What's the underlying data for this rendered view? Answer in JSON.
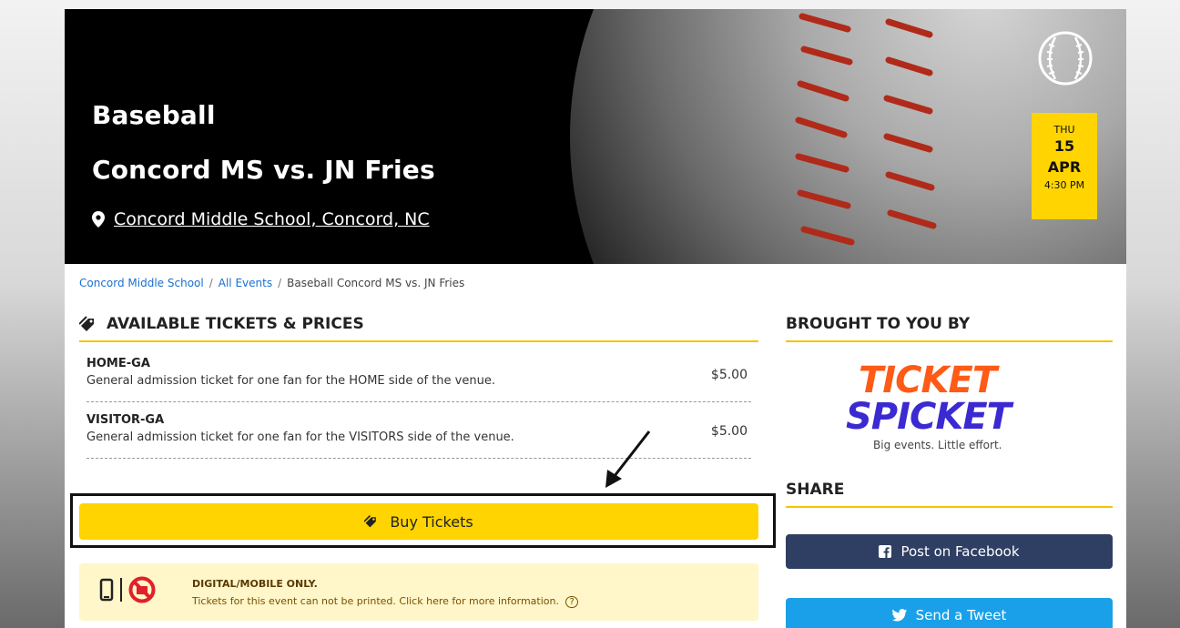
{
  "hero": {
    "sport": "Baseball",
    "matchup": "Concord MS vs. JN Fries",
    "venue": "Concord Middle School, Concord, NC",
    "date": {
      "dow": "THU",
      "day": "15",
      "month": "APR",
      "time": "4:30 PM"
    }
  },
  "breadcrumb": {
    "school": "Concord Middle School",
    "all_events": "All Events",
    "current": "Baseball Concord MS vs. JN Fries",
    "separator": "/"
  },
  "tickets_section": {
    "heading": "AVAILABLE TICKETS & PRICES",
    "tickets": [
      {
        "name": "HOME-GA",
        "description": "General admission ticket for one fan for the HOME side of the venue.",
        "price": "$5.00"
      },
      {
        "name": "VISITOR-GA",
        "description": "General admission ticket for one fan for the VISITORS side of the venue.",
        "price": "$5.00"
      }
    ],
    "buy_label": "Buy Tickets"
  },
  "notice": {
    "title": "DIGITAL/MOBILE ONLY.",
    "body": "Tickets for this event can not be printed. Click here for more information.",
    "help_glyph": "?"
  },
  "sidebar": {
    "brought_heading": "BROUGHT TO YOU BY",
    "logo": {
      "line1": "TICKET",
      "line2": "SPICKET",
      "tagline": "Big events. Little effort."
    },
    "share_heading": "SHARE",
    "facebook_label": "Post on Facebook",
    "twitter_label": "Send a Tweet"
  },
  "colors": {
    "accent_yellow": "#ffd400",
    "link_blue": "#1a6fcf",
    "facebook": "#2f3f63",
    "twitter": "#1aa0e8",
    "notice_bg": "#fff6c9"
  }
}
